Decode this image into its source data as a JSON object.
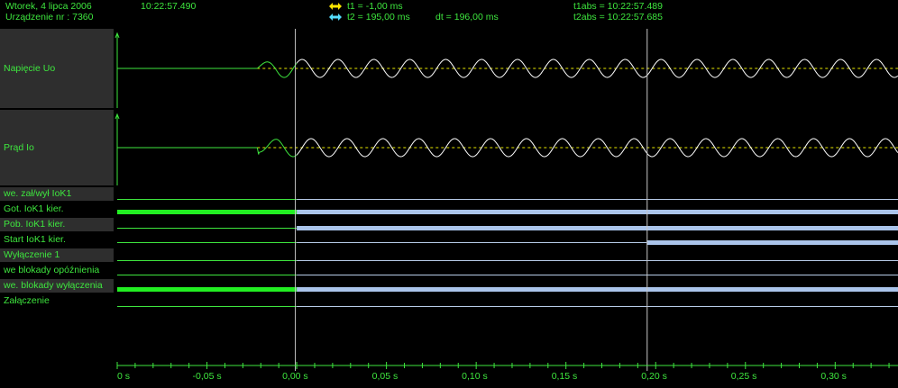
{
  "header": {
    "date": "Wtorek,  4  lipca  2006",
    "device": "Urządzenie nr :  7360",
    "time": "10:22:57.490",
    "t1": "t1 = -1,00 ms",
    "t2": "t2 = 195,00 ms",
    "dt": "dt = 196,00 ms",
    "t1abs": "t1abs = 10:22:57.489",
    "t2abs": "t2abs = 10:22:57.685",
    "t1_icon": "double-arrow-yellow-icon",
    "t2_icon": "double-arrow-cyan-icon"
  },
  "colors": {
    "text": "#3ee63e",
    "wave": "#ffffff",
    "reference": "#e8e800",
    "cursor": "#c8c8c8",
    "digital_high_pre": "#22ee22",
    "digital_high_post": "#aac4ea",
    "digital_low": "#b8cce8",
    "t1_arrow": "#ffe600",
    "t2_arrow": "#55ddff"
  },
  "analog_channels": [
    {
      "name": "Napięcie Uo"
    },
    {
      "name": "Prąd Io"
    }
  ],
  "digital_channels": [
    {
      "name": "we. zał/wył IoK1",
      "high_from": null
    },
    {
      "name": "Got. IoK1 kier.",
      "high_from": -0.1
    },
    {
      "name": "Pob. IoK1 kier.",
      "high_from": 0.0
    },
    {
      "name": "Start IoK1 kier.",
      "high_from": 0.195
    },
    {
      "name": "Wyłączenie 1",
      "high_from": null
    },
    {
      "name": "we blokady opóźnienia",
      "high_from": null
    },
    {
      "name": "we. blokady wyłączenia",
      "high_from": -0.1
    },
    {
      "name": "Załączenie",
      "high_from": null
    }
  ],
  "time_axis": {
    "labels": [
      "0 s",
      "-0,05 s",
      "0,00 s",
      "0,05 s",
      "0,10 s",
      "0,15 s",
      "0,20 s",
      "0,25 s",
      "0,30 s"
    ],
    "range": [
      -0.1,
      0.335
    ],
    "cursor_t1": -0.001,
    "cursor_t2": 0.195
  },
  "signal": {
    "start_time": -0.022,
    "period": 0.02
  }
}
